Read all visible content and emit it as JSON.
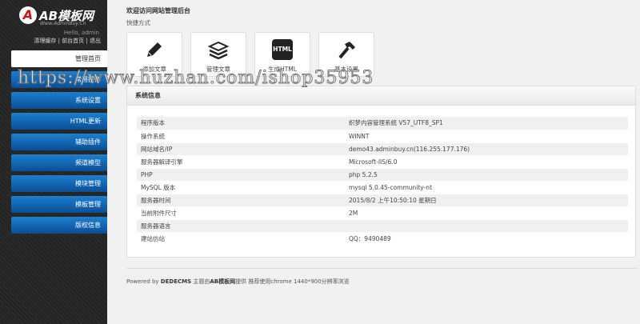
{
  "sidebar": {
    "logo_text": "AB模板网",
    "logo_sub": "Www.AdminBuy.Cn",
    "hello": "Hello, admin",
    "links": [
      "清理缓存",
      "前台首页",
      "退出"
    ],
    "menu": [
      "管理首页",
      "常用操作",
      "系统设置",
      "HTML更新",
      "辅助插件",
      "频道模型",
      "模块管理",
      "模板管理",
      "版权信息"
    ]
  },
  "main": {
    "title": "欢迎访问网站管理后台",
    "quick_label": "快捷方式",
    "shortcuts": [
      {
        "label": "添加文章",
        "icon": "pencil-icon"
      },
      {
        "label": "管理文章",
        "icon": "stack-icon"
      },
      {
        "label": "生成HTML",
        "icon": "html-icon",
        "icon_text": "HTML"
      },
      {
        "label": "基本设置",
        "icon": "hammer-icon"
      }
    ],
    "sysinfo": {
      "title": "系统信息",
      "rows": [
        [
          "程序版本",
          "织梦内容管理系统 V57_UTF8_SP1"
        ],
        [
          "操作系统",
          "WINNT"
        ],
        [
          "网站域名/IP",
          "demo43.adminbuy.cn(116.255.177.176)"
        ],
        [
          "服务器解译引擎",
          "Microsoft-IIS/6.0"
        ],
        [
          "PHP",
          "php 5.2.5"
        ],
        [
          "MySQL 版本",
          "mysql 5.0.45-community-nt"
        ],
        [
          "服务器时间",
          "2015/8/2 上午10:50:10 星期日"
        ],
        [
          "当前附件尺寸",
          "2M"
        ],
        [
          "服务器语言",
          ""
        ],
        [
          "建站仿站",
          "QQ：9490489"
        ]
      ]
    },
    "footer": {
      "pre": "Powered by ",
      "brand": "DEDECMS",
      "mid": " 主题由",
      "ab": "AB模板网",
      "post": "提供 推荐使用chrome 1440*900分辨率浏览"
    }
  },
  "watermark": "https://www.huzhan.com/ishop35953",
  "colors": {
    "menu_blue": "#1c7fd0",
    "sidebar": "#262626"
  }
}
